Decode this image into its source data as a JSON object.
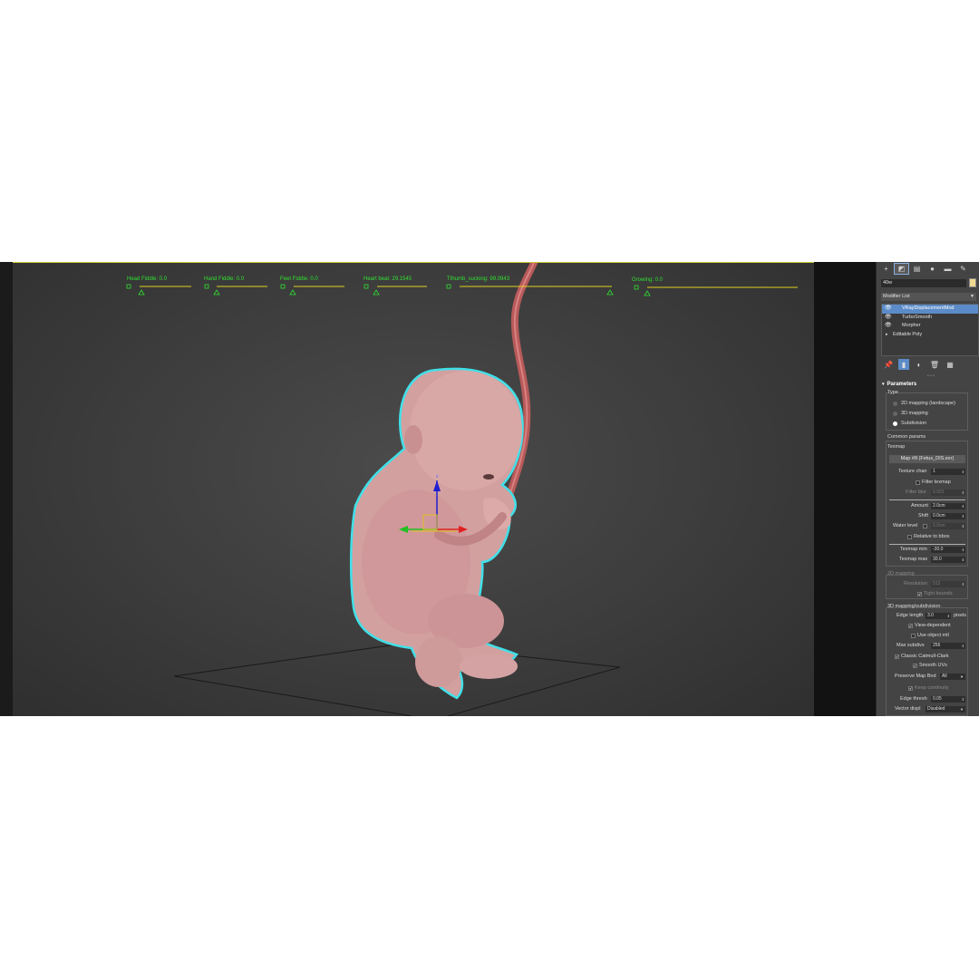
{
  "viewport": {
    "sliders": [
      {
        "label": "Head Fiddle: 0.0"
      },
      {
        "label": "Hand Fiddle: 0.0"
      },
      {
        "label": "Feet Fiddle: 0.0"
      },
      {
        "label": "Heart beat: 29.1545"
      },
      {
        "label": "Tthumb_sucking: 99.0943"
      },
      {
        "label": "Growing: 0.0"
      }
    ],
    "gizmo_axis_label": "z",
    "colors": {
      "selection_outline": "#40e0e8",
      "slider_label": "#30e030",
      "skin": "#d4a0a0",
      "umbilical": "#b85a5a"
    }
  },
  "command_panel": {
    "tabs": [
      "+",
      "modify-icon",
      "hierarchy-icon",
      "motion-icon",
      "display-icon",
      "utilities-icon"
    ],
    "object_name": "40w",
    "modifier_list_label": "Modifier List",
    "modifier_stack": [
      {
        "label": "VRayDisplacementMod",
        "selected": true,
        "eye": true
      },
      {
        "label": "TurboSmooth",
        "selected": false,
        "eye": true
      },
      {
        "label": "Morpher",
        "selected": false,
        "eye": true
      },
      {
        "label": "Editable Poly",
        "selected": false,
        "eye": false
      }
    ],
    "rollout_title": "Parameters",
    "type_group": {
      "title": "Type",
      "options": [
        "2D mapping (landscape)",
        "3D mapping",
        "Subdivision"
      ],
      "selected_index": 2
    },
    "common_params": {
      "title": "Common params",
      "texmap_label": "Texmap",
      "texmap_button": "Map #8 (Fetus_DIS.exr)",
      "texture_chan_label": "Texture chan",
      "texture_chan_value": "1",
      "filter_texmap_label": "Filter texmap",
      "filter_blur_label": "Filter blur",
      "filter_blur_value": "0.001",
      "amount_label": "Amount",
      "amount_value": "2.0cm",
      "shift_label": "Shift",
      "shift_value": "0.0cm",
      "water_level_label": "Water level",
      "water_level_value": "0.0cm",
      "relative_bbox_label": "Relative to bbox",
      "texmap_min_label": "Texmap min",
      "texmap_min_value": "-30.0",
      "texmap_max_label": "Texmap max",
      "texmap_max_value": "30.0"
    },
    "mapping_2d": {
      "title": "2D mapping",
      "resolution_label": "Resolution",
      "resolution_value": "512",
      "tight_bounds_label": "Tight bounds"
    },
    "mapping_3d": {
      "title": "3D mapping/subdivision",
      "edge_length_label": "Edge length",
      "edge_length_value": "3.0",
      "pixels_label": "pixels",
      "view_dependent_label": "View-dependent",
      "use_object_mtl_label": "Use object mtl",
      "max_subdivs_label": "Max subdivs",
      "max_subdivs_value": "256",
      "catmull_label": "Classic Catmull-Clark",
      "smooth_uvs_label": "Smooth UVs",
      "preserve_map_label": "Preserve Map Bnd",
      "preserve_map_value": "All",
      "keep_continuity_label": "Keep continuity",
      "edge_thresh_label": "Edge thresh",
      "edge_thresh_value": "0.05",
      "vector_displ_label": "Vector displ",
      "vector_displ_value": "Disabled"
    },
    "accent": "#5b8bc8"
  }
}
